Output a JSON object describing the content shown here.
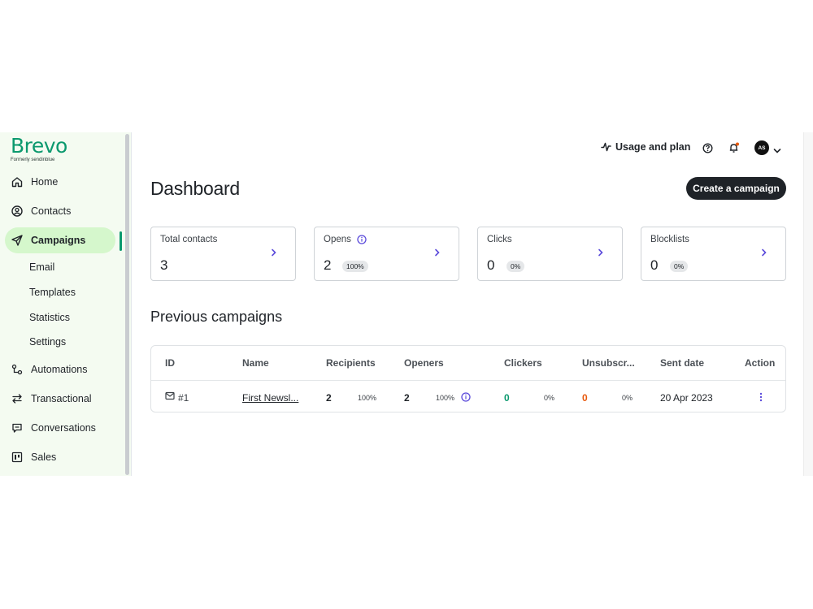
{
  "brand": {
    "name": "Brevo",
    "tagline": "Formerly sendinblue",
    "color": "#0b996e"
  },
  "sidebar": {
    "items": [
      {
        "label": "Home",
        "icon": "home-icon"
      },
      {
        "label": "Contacts",
        "icon": "user-circle-icon"
      },
      {
        "label": "Campaigns",
        "icon": "send-icon",
        "active": true
      },
      {
        "label": "Automations",
        "icon": "automation-icon"
      },
      {
        "label": "Transactional",
        "icon": "arrows-exchange-icon"
      },
      {
        "label": "Conversations",
        "icon": "chat-icon"
      },
      {
        "label": "Sales",
        "icon": "kanban-icon"
      }
    ],
    "campaign_subitems": [
      "Email",
      "Templates",
      "Statistics",
      "Settings"
    ]
  },
  "header": {
    "usage_label": "Usage and plan",
    "avatar_initials": "AS",
    "notification_dot_color": "#e8590c"
  },
  "page": {
    "title": "Dashboard",
    "create_button": "Create a campaign"
  },
  "stats": [
    {
      "label": "Total contacts",
      "value": "3",
      "badge": ""
    },
    {
      "label": "Opens",
      "value": "2",
      "badge": "100%"
    },
    {
      "label": "Clicks",
      "value": "0",
      "badge": "0%"
    },
    {
      "label": "Blocklists",
      "value": "0",
      "badge": "0%"
    }
  ],
  "campaigns": {
    "heading": "Previous campaigns",
    "columns": [
      "ID",
      "Name",
      "Recipients",
      "Openers",
      "Clickers",
      "Unsubscr...",
      "Sent date",
      "Action"
    ],
    "rows": [
      {
        "id": "#1",
        "name": "First Newsl...",
        "recipients": "2",
        "recipients_pct": "100%",
        "openers": "2",
        "openers_pct": "100%",
        "clickers": "0",
        "clickers_pct": "0%",
        "unsubscribers": "0",
        "unsubscribers_pct": "0%",
        "sent_date": "20 Apr 2023"
      }
    ]
  },
  "colors": {
    "accent": "#0b996e",
    "active_bg": "#d5f7cc",
    "sidebar_bg": "#f4fbf1",
    "link_icon": "#5b4bdb",
    "orange": "#e8590c"
  }
}
